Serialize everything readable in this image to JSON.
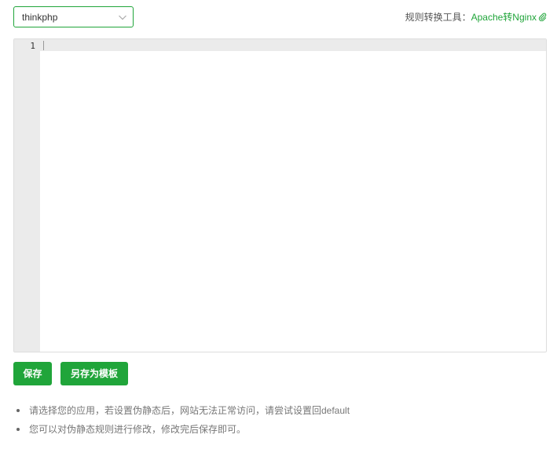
{
  "rewrite_select": {
    "selected": "thinkphp"
  },
  "converter": {
    "label": "规则转换工具：",
    "link_text": "Apache转Nginx",
    "link_icon": "paperclip-icon"
  },
  "editor": {
    "line_numbers": [
      "1"
    ],
    "content": ""
  },
  "buttons": {
    "save": "保存",
    "save_as_template": "另存为模板"
  },
  "tips": [
    "请选择您的应用，若设置伪静态后，网站无法正常访问，请尝试设置回default",
    "您可以对伪静态规则进行修改，修改完后保存即可。"
  ],
  "colors": {
    "accent": "#20a53a",
    "gutter": "#ebebeb"
  }
}
